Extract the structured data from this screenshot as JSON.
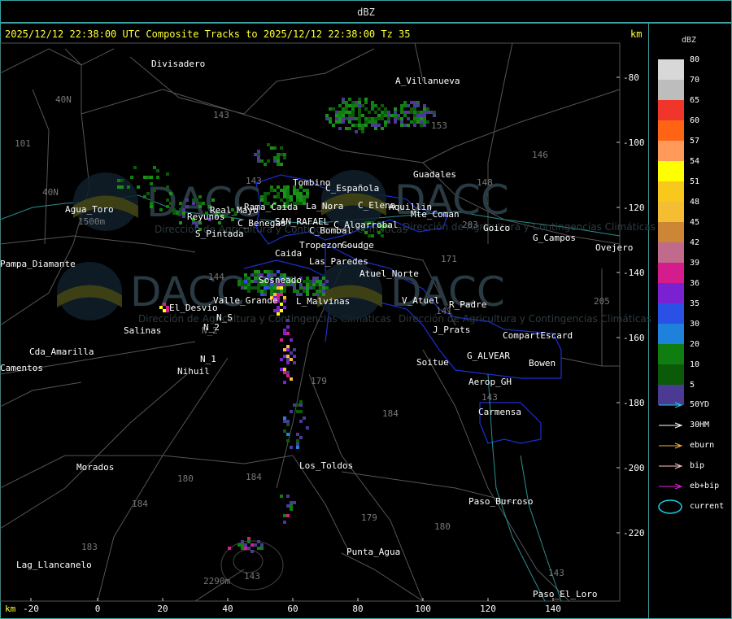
{
  "window_title": "dBZ",
  "headline": "2025/12/12 22:38:00 UTC Composite Tracks to 2025/12/12 22:38:00 Tz 35",
  "km_label": "km",
  "legend": {
    "title": "dBZ",
    "scale": [
      {
        "label": "80",
        "color": "#d8d8d8"
      },
      {
        "label": "70",
        "color": "#bdbdbd"
      },
      {
        "label": "65",
        "color": "#f0352a"
      },
      {
        "label": "60",
        "color": "#ff6414"
      },
      {
        "label": "57",
        "color": "#ff9a5a"
      },
      {
        "label": "54",
        "color": "#ffff00"
      },
      {
        "label": "51",
        "color": "#f8c91c"
      },
      {
        "label": "48",
        "color": "#f5be32"
      },
      {
        "label": "45",
        "color": "#cd8536"
      },
      {
        "label": "42",
        "color": "#c06a8c"
      },
      {
        "label": "39",
        "color": "#d41c8c"
      },
      {
        "label": "36",
        "color": "#7a22d2"
      },
      {
        "label": "35",
        "color": "#2a50e6"
      },
      {
        "label": "30",
        "color": "#1e82dc"
      },
      {
        "label": "20",
        "color": "#0f7d0f"
      },
      {
        "label": "10",
        "color": "#0a5a0a"
      },
      {
        "label": "5",
        "color": "#4a3a94"
      }
    ],
    "tracks": [
      {
        "label": "50YD",
        "color": "#19d2e6"
      },
      {
        "label": "30HM",
        "color": "#ffffff"
      },
      {
        "label": "eburn",
        "color": "#f5b43c"
      },
      {
        "label": "bip",
        "color": "#ffc8c8"
      },
      {
        "label": "eb+bip",
        "color": "#e61ee6"
      },
      {
        "label": "current",
        "color": "#19d2e6"
      }
    ]
  },
  "axes": {
    "x_ticks": [
      "-20",
      "0",
      "20",
      "40",
      "60",
      "80",
      "100",
      "120",
      "140"
    ],
    "y_ticks": [
      "-80",
      "-100",
      "-120",
      "-140",
      "-160",
      "-180",
      "-200",
      "-220"
    ]
  },
  "places": [
    {
      "name": "Divisadero"
    },
    {
      "name": "A_Villanueva"
    },
    {
      "name": "Guadales"
    },
    {
      "name": "Tombino"
    },
    {
      "name": "C_Española"
    },
    {
      "name": "La_Nora"
    },
    {
      "name": "C_Elena"
    },
    {
      "name": "Aquillin"
    },
    {
      "name": "Mte_Coman"
    },
    {
      "name": "Rama_Caida"
    },
    {
      "name": "SAN_RAFAEL"
    },
    {
      "name": "Real_Mayo"
    },
    {
      "name": "C_Benegas"
    },
    {
      "name": "C_Algarrobal"
    },
    {
      "name": "C_Bombal"
    },
    {
      "name": "Goico"
    },
    {
      "name": "G_Campos"
    },
    {
      "name": "Ovejero"
    },
    {
      "name": "Reyunos"
    },
    {
      "name": "S_Pintada"
    },
    {
      "name": "Tropezon"
    },
    {
      "name": "Goudge"
    },
    {
      "name": "Caida"
    },
    {
      "name": "Las_Paredes"
    },
    {
      "name": "Atuel_Norte"
    },
    {
      "name": "Pampa_Diamante"
    },
    {
      "name": "Agua_Toro"
    },
    {
      "name": "Valle_Grande"
    },
    {
      "name": "L_Malvinas"
    },
    {
      "name": "V_Atuel"
    },
    {
      "name": "R_Padre"
    },
    {
      "name": "El_Desvio"
    },
    {
      "name": "Salinas"
    },
    {
      "name": "N_2"
    },
    {
      "name": "N_S"
    },
    {
      "name": "J_Prats"
    },
    {
      "name": "CompartEscard"
    },
    {
      "name": "Cda_Amarilla"
    },
    {
      "name": "N_1"
    },
    {
      "name": "Nihuil"
    },
    {
      "name": "G_ALVEAR"
    },
    {
      "name": "Soitue"
    },
    {
      "name": "Bowen"
    },
    {
      "name": "Aerop_GH"
    },
    {
      "name": "Carmensa"
    },
    {
      "name": "Morados"
    },
    {
      "name": "Los_Toldos"
    },
    {
      "name": "Paso_Burroso"
    },
    {
      "name": "Punta_Agua"
    },
    {
      "name": "Lag_Llancanelo"
    },
    {
      "name": "Paso_El_Loro"
    },
    {
      "name": "Sosneado"
    },
    {
      "name": "Camentos"
    }
  ],
  "route_labels": [
    "143",
    "153",
    "146",
    "101",
    "40N",
    "40N",
    "148",
    "143",
    "203",
    "171",
    "141",
    "144",
    "179",
    "184",
    "180",
    "184",
    "179",
    "180",
    "184",
    "183",
    "143",
    "205",
    "143",
    "143",
    "2290m",
    "1500m",
    "N_2"
  ],
  "watermark": "DACC",
  "watermark_sub": "Dirección de Agricultura y Contingencias Climáticas"
}
